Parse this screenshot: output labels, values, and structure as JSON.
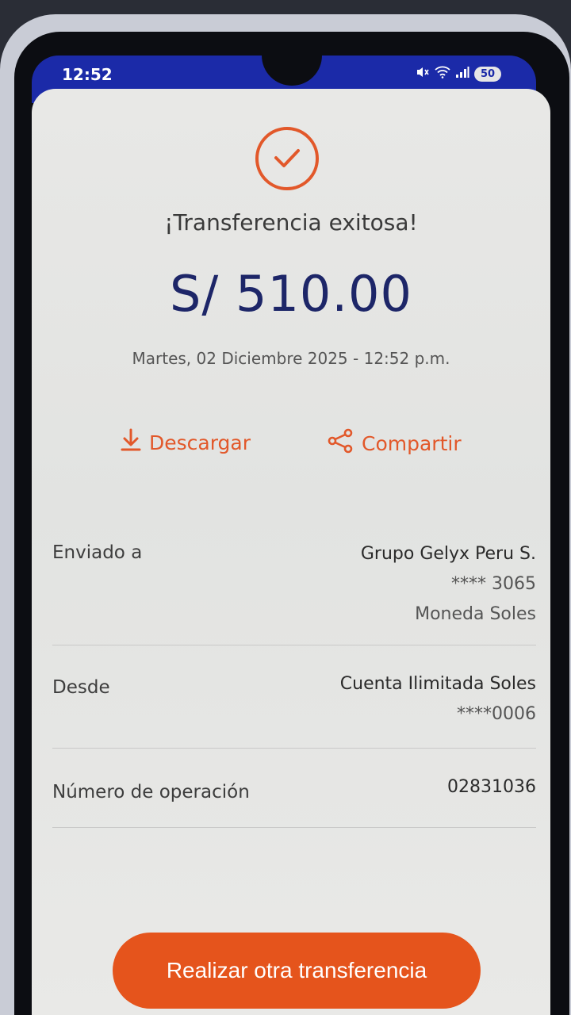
{
  "status_bar": {
    "time": "12:52",
    "battery": "50",
    "icons": [
      "mute-icon",
      "wifi-icon",
      "signal-icon"
    ]
  },
  "receipt": {
    "title": "¡Transferencia exitosa!",
    "amount": "S/ 510.00",
    "datetime": "Martes, 02 Diciembre 2025 - 12:52 p.m."
  },
  "actions": {
    "download_label": "Descargar",
    "share_label": "Compartir"
  },
  "details": {
    "sent_to": {
      "label": "Enviado a",
      "name": "Grupo Gelyx Peru S.",
      "account": "**** 3065",
      "currency": "Moneda Soles"
    },
    "from": {
      "label": "Desde",
      "account_name": "Cuenta Ilimitada Soles",
      "account": "****0006"
    },
    "operation": {
      "label": "Número de operación",
      "number": "02831036"
    }
  },
  "cta": {
    "label": "Realizar otra transferencia"
  },
  "colors": {
    "accent": "#e5541c",
    "amount": "#1d2668",
    "status_bar": "#1b2aa8"
  }
}
